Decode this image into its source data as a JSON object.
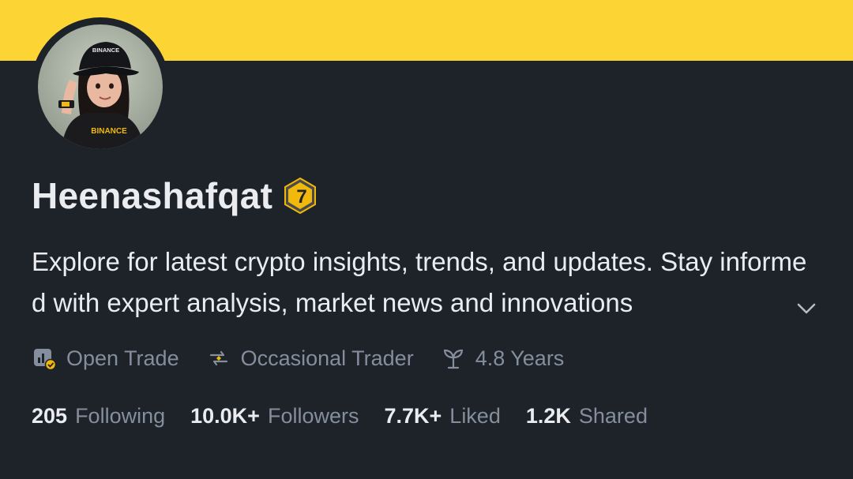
{
  "colors": {
    "banner": "#fcd535",
    "background": "#1e2329",
    "text_primary": "#eaecef",
    "text_secondary": "#848e9c",
    "accent": "#f0b90b"
  },
  "profile": {
    "name": "Heenashafqat",
    "badge_icon": "level-7-badge-icon",
    "badge_level": "7",
    "avatar_caption": "BINANCE",
    "bio": "Explore for latest crypto insights, trends, and updates. Stay informed with expert analysis, market news and innovations"
  },
  "meta": [
    {
      "icon": "open-trade-icon",
      "label": "Open Trade"
    },
    {
      "icon": "occasional-trader-icon",
      "label": "Occasional Trader"
    },
    {
      "icon": "sprout-icon",
      "label": "4.8 Years"
    }
  ],
  "stats": [
    {
      "value": "205",
      "label": "Following"
    },
    {
      "value": "10.0K+",
      "label": "Followers"
    },
    {
      "value": "7.7K+",
      "label": "Liked"
    },
    {
      "value": "1.2K",
      "label": "Shared"
    }
  ]
}
